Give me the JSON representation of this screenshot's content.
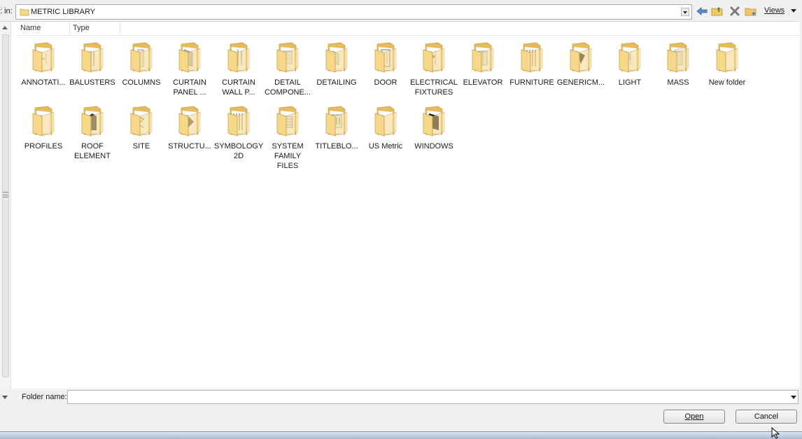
{
  "window": {
    "look_in_label": ": in:",
    "current_path": "METRIC LIBRARY",
    "views_label": "Views"
  },
  "columns": [
    {
      "label": "Name"
    },
    {
      "label": "Type"
    }
  ],
  "folders": [
    {
      "label": "ANNOTATI...",
      "glyph": "pin"
    },
    {
      "label": "BALUSTERS",
      "glyph": "bars"
    },
    {
      "label": "COLUMNS",
      "glyph": "column"
    },
    {
      "label": "CURTAIN\nPANEL ...",
      "glyph": "panel"
    },
    {
      "label": "CURTAIN\nWALL P...",
      "glyph": "wall"
    },
    {
      "label": "DETAIL\nCOMPONE...",
      "glyph": "detail"
    },
    {
      "label": "DETAILING",
      "glyph": "detailing"
    },
    {
      "label": "DOOR",
      "glyph": "door"
    },
    {
      "label": "ELECTRICAL\nFIXTURES",
      "glyph": "electrical"
    },
    {
      "label": "ELEVATOR",
      "glyph": "elevator"
    },
    {
      "label": "FURNITURE",
      "glyph": "furniture"
    },
    {
      "label": "GENERICM...",
      "glyph": "generic"
    },
    {
      "label": "LIGHT",
      "glyph": "light"
    },
    {
      "label": "MASS",
      "glyph": "mass"
    },
    {
      "label": "New folder",
      "glyph": "none"
    },
    {
      "label": "PROFILES",
      "glyph": "profiles"
    },
    {
      "label": "ROOF\nELEMENT",
      "glyph": "roof"
    },
    {
      "label": "SITE",
      "glyph": "site"
    },
    {
      "label": "STRUCTU...",
      "glyph": "structure"
    },
    {
      "label": "SYMBOLOGY\n2D",
      "glyph": "symbology"
    },
    {
      "label": "SYSTEM\nFAMILY FILES",
      "glyph": "system"
    },
    {
      "label": "TITLEBLO...",
      "glyph": "titleblock"
    },
    {
      "label": "US Metric",
      "glyph": "usmetric"
    },
    {
      "label": "WINDOWS",
      "glyph": "windows"
    }
  ],
  "folder_name": {
    "label": "Folder name:",
    "value": ""
  },
  "buttons": {
    "open": "Open",
    "cancel": "Cancel"
  },
  "colors": {
    "folder_fill": "#f5d88a",
    "folder_dark": "#e6bc5a",
    "accent_blue": "#4a78b5"
  }
}
